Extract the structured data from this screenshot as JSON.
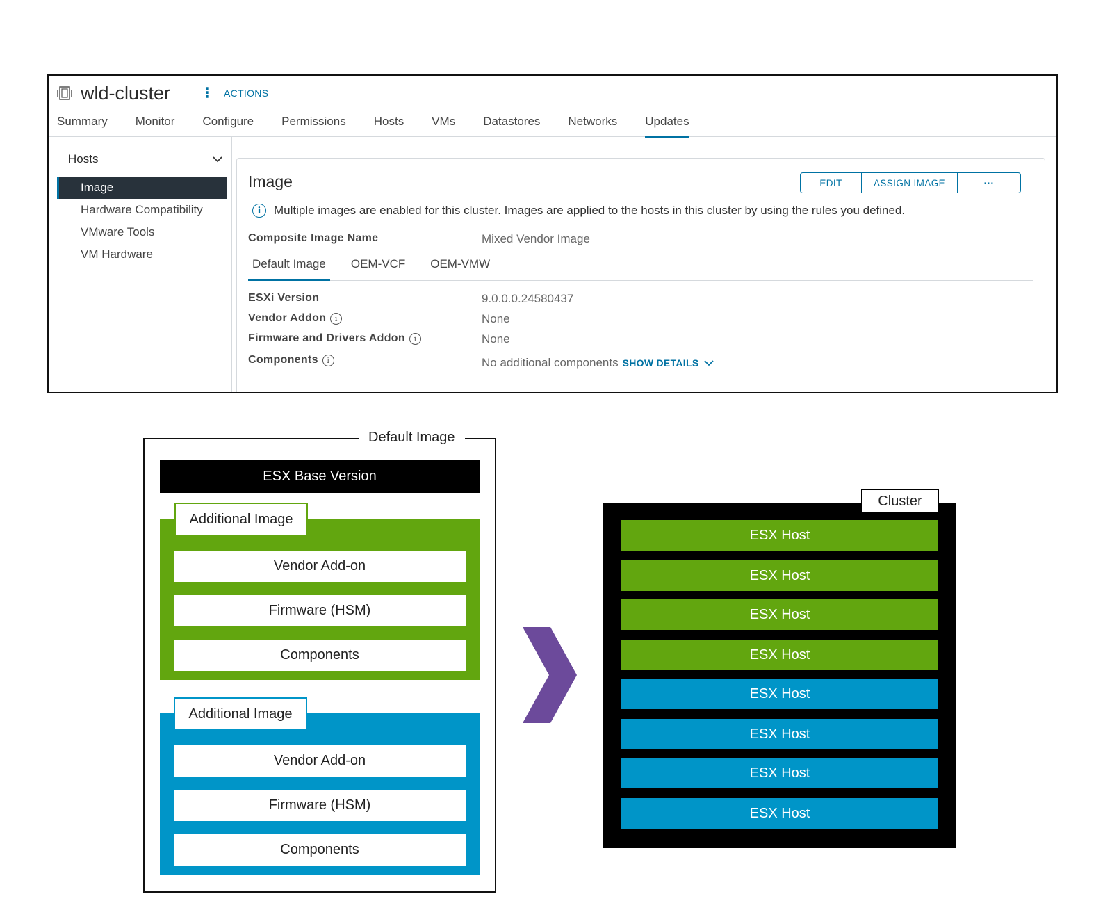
{
  "header": {
    "object_title": "wld-cluster",
    "actions_label": "ACTIONS",
    "object_icon": "cluster-icon"
  },
  "tabs": [
    {
      "label": "Summary"
    },
    {
      "label": "Monitor"
    },
    {
      "label": "Configure"
    },
    {
      "label": "Permissions"
    },
    {
      "label": "Hosts"
    },
    {
      "label": "VMs"
    },
    {
      "label": "Datastores"
    },
    {
      "label": "Networks"
    },
    {
      "label": "Updates",
      "active": true
    }
  ],
  "sidebar": {
    "group_label": "Hosts",
    "items": [
      {
        "label": "Image",
        "active": true
      },
      {
        "label": "Hardware Compatibility"
      },
      {
        "label": "VMware Tools"
      },
      {
        "label": "VM Hardware"
      }
    ]
  },
  "image_panel": {
    "title": "Image",
    "buttons": {
      "edit": "EDIT",
      "assign": "ASSIGN IMAGE",
      "more": "···"
    },
    "info_message": "Multiple images are enabled for this cluster. Images are applied to the hosts in this cluster by using the rules you defined.",
    "composite_label": "Composite Image Name",
    "composite_value": "Mixed Vendor Image",
    "subtabs": [
      {
        "label": "Default Image",
        "active": true
      },
      {
        "label": "OEM-VCF"
      },
      {
        "label": "OEM-VMW"
      }
    ],
    "properties": [
      {
        "label": "ESXi Version",
        "value": "9.0.0.0.24580437",
        "info": false
      },
      {
        "label": "Vendor Addon",
        "value": "None",
        "info": true
      },
      {
        "label": "Firmware and Drivers Addon",
        "value": "None",
        "info": true
      },
      {
        "label": "Components",
        "value": "No additional components",
        "info": true
      }
    ],
    "show_details": "SHOW DETAILS"
  },
  "diagram": {
    "default_image_label": "Default Image",
    "base_version": "ESX Base Version",
    "additional_images": [
      {
        "label": "Additional Image",
        "color": "#62a60f",
        "items": [
          "Vendor Add-on",
          "Firmware (HSM)",
          "Components"
        ]
      },
      {
        "label": "Additional Image",
        "color": "#0095c8",
        "items": [
          "Vendor Add-on",
          "Firmware (HSM)",
          "Components"
        ]
      }
    ],
    "arrow_color": "#6c4a9b",
    "cluster_label": "Cluster",
    "hosts": [
      {
        "label": "ESX Host",
        "color": "green"
      },
      {
        "label": "ESX Host",
        "color": "green"
      },
      {
        "label": "ESX Host",
        "color": "green"
      },
      {
        "label": "ESX Host",
        "color": "green"
      },
      {
        "label": "ESX Host",
        "color": "blue"
      },
      {
        "label": "ESX Host",
        "color": "blue"
      },
      {
        "label": "ESX Host",
        "color": "blue"
      },
      {
        "label": "ESX Host",
        "color": "blue"
      }
    ]
  },
  "colors": {
    "accent": "#0072a3",
    "green": "#62a60f",
    "blue": "#0095c8",
    "nav_active_bg": "#28323b"
  }
}
